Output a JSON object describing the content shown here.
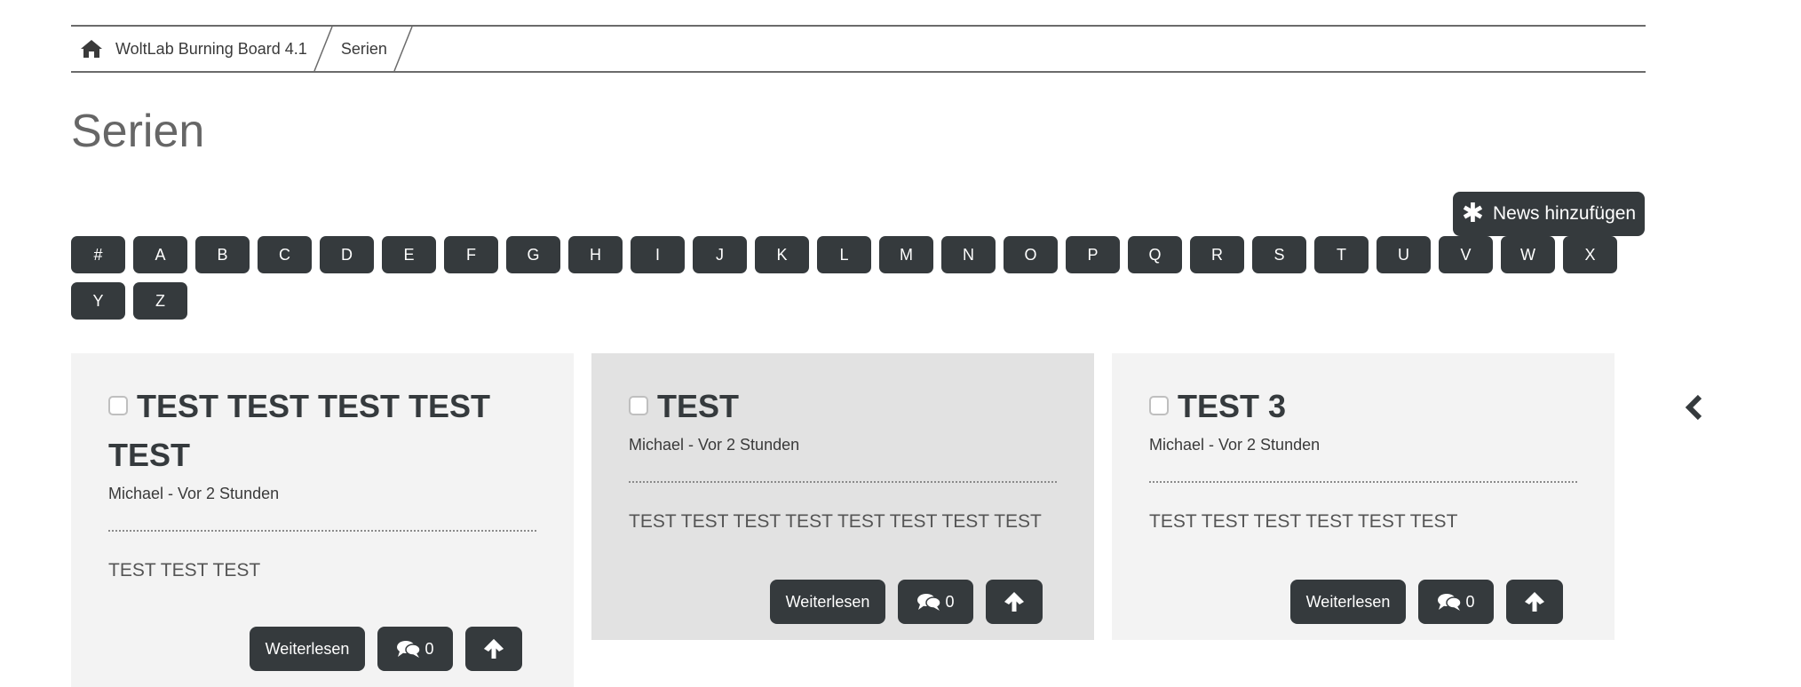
{
  "breadcrumb": {
    "items": [
      {
        "label": "WoltLab Burning Board 4.1",
        "icon": "home-icon"
      },
      {
        "label": "Serien"
      }
    ]
  },
  "page": {
    "title": "Serien",
    "add_button_label": "News hinzufügen",
    "add_button_icon": "asterisk-icon"
  },
  "letters": [
    "#",
    "A",
    "B",
    "C",
    "D",
    "E",
    "F",
    "G",
    "H",
    "I",
    "J",
    "K",
    "L",
    "M",
    "N",
    "O",
    "P",
    "Q",
    "R",
    "S",
    "T",
    "U",
    "V",
    "W",
    "X",
    "Y",
    "Z"
  ],
  "cards": [
    {
      "title": "TEST TEST TEST TEST TEST",
      "meta": "Michael - Vor 2 Stunden",
      "text": "TEST TEST TEST",
      "read_label": "Weiterlesen",
      "comments": "0"
    },
    {
      "title": "TEST",
      "meta": "Michael - Vor 2 Stunden",
      "text": "TEST TEST TEST TEST TEST TEST TEST TEST",
      "read_label": "Weiterlesen",
      "comments": "0"
    },
    {
      "title": "TEST 3",
      "meta": "Michael - Vor 2 Stunden",
      "text": "TEST TEST TEST TEST TEST TEST",
      "read_label": "Weiterlesen",
      "comments": "0"
    }
  ],
  "colors": {
    "button_bg": "#353a3d",
    "card_bg": "#f3f3f3",
    "card_bg_hover": "#e2e2e2"
  }
}
